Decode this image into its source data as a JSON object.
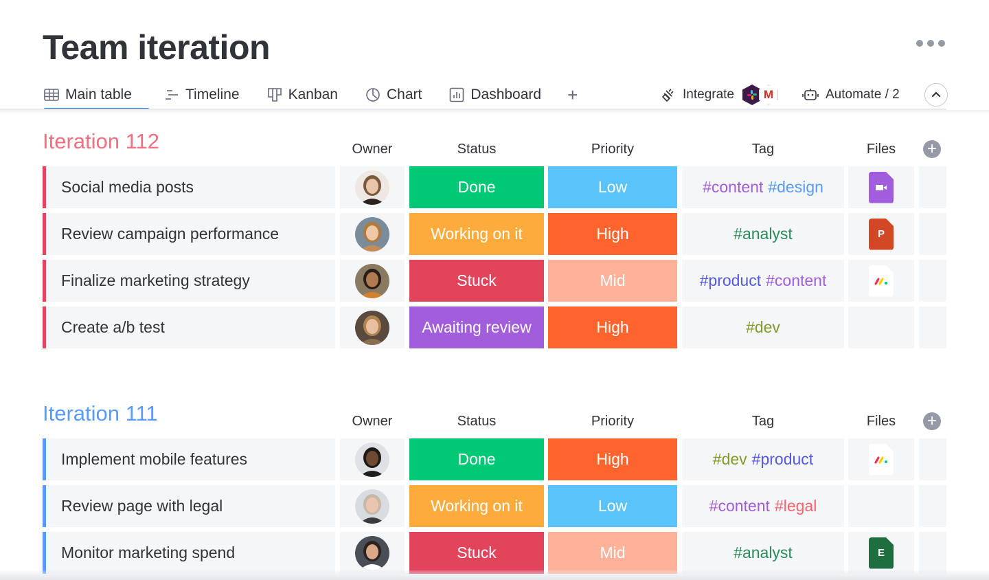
{
  "header": {
    "title": "Team iteration",
    "more_icon": "ellipsis-icon"
  },
  "tabs": [
    {
      "label": "Main table",
      "icon": "table-icon",
      "active": true
    },
    {
      "label": "Timeline",
      "icon": "timeline-icon",
      "active": false
    },
    {
      "label": "Kanban",
      "icon": "kanban-icon",
      "active": false
    },
    {
      "label": "Chart",
      "icon": "chart-pie-icon",
      "active": false
    },
    {
      "label": "Dashboard",
      "icon": "dashboard-icon",
      "active": false
    }
  ],
  "add_view_label": "+",
  "toolbar": {
    "integrate_label": "Integrate",
    "integrate_apps": [
      "slack-icon",
      "gmail-icon"
    ],
    "gmail_glyph": "M",
    "automate_label": "Automate / 2",
    "collapse_icon": "chevron-up-icon"
  },
  "columns": {
    "owner": "Owner",
    "status": "Status",
    "priority": "Priority",
    "tag": "Tag",
    "files": "Files"
  },
  "colors": {
    "accent": "#0073ea",
    "group_1": "#e2445c",
    "group_1_title": "#f16f7e",
    "group_2": "#579bfc",
    "status_done": "#00c875",
    "status_working": "#fdab3d",
    "status_stuck": "#e2445c",
    "status_awaiting": "#a25ddc",
    "priority_low": "#5ac4fa",
    "priority_high": "#ff642e",
    "priority_mid": "#ffb199",
    "tag_content": "#a25ddc",
    "tag_design": "#579bfc",
    "tag_analyst": "#2b8c5a",
    "tag_product": "#5559df",
    "tag_dev": "#7e9b2a",
    "tag_legal": "#f0646e"
  },
  "groups": [
    {
      "title": "Iteration 112",
      "rows": [
        {
          "name": "Social media posts",
          "owner": "avatar-woman-1",
          "status": "Done",
          "status_color": "#00c875",
          "priority": "Low",
          "priority_color": "#5ac4fa",
          "tags": [
            {
              "text": "#content",
              "color": "#a25ddc"
            },
            {
              "text": "#design",
              "color": "#579bfc"
            }
          ],
          "file": "video",
          "file_label": ""
        },
        {
          "name": "Review campaign performance",
          "owner": "avatar-woman-2",
          "status": "Working on it",
          "status_color": "#fdab3d",
          "priority": "High",
          "priority_color": "#ff642e",
          "tags": [
            {
              "text": "#analyst",
              "color": "#2b8c5a"
            }
          ],
          "file": "ppt",
          "file_label": "P"
        },
        {
          "name": "Finalize marketing strategy",
          "owner": "avatar-man-1",
          "status": "Stuck",
          "status_color": "#e2445c",
          "priority": "Mid",
          "priority_color": "#ffb199",
          "tags": [
            {
              "text": "#product",
              "color": "#5559df"
            },
            {
              "text": "#content",
              "color": "#a25ddc"
            }
          ],
          "file": "monday",
          "file_label": ""
        },
        {
          "name": "Create a/b test",
          "owner": "avatar-woman-3",
          "status": "Awaiting review",
          "status_color": "#a25ddc",
          "priority": "High",
          "priority_color": "#ff642e",
          "tags": [
            {
              "text": "#dev",
              "color": "#7e9b2a"
            }
          ],
          "file": "",
          "file_label": ""
        }
      ]
    },
    {
      "title": "Iteration 111",
      "rows": [
        {
          "name": "Implement mobile features",
          "owner": "avatar-man-2",
          "status": "Done",
          "status_color": "#00c875",
          "priority": "High",
          "priority_color": "#ff642e",
          "tags": [
            {
              "text": "#dev",
              "color": "#7e9b2a"
            },
            {
              "text": "#product",
              "color": "#5559df"
            }
          ],
          "file": "monday",
          "file_label": ""
        },
        {
          "name": "Review page with legal",
          "owner": "avatar-man-3",
          "status": "Working on it",
          "status_color": "#fdab3d",
          "priority": "Low",
          "priority_color": "#5ac4fa",
          "tags": [
            {
              "text": "#content",
              "color": "#a25ddc"
            },
            {
              "text": "#legal",
              "color": "#f0646e"
            }
          ],
          "file": "",
          "file_label": ""
        },
        {
          "name": "Monitor marketing spend",
          "owner": "avatar-woman-4",
          "status": "Stuck",
          "status_color": "#e2445c",
          "priority": "Mid",
          "priority_color": "#ffb199",
          "tags": [
            {
              "text": "#analyst",
              "color": "#2b8c5a"
            }
          ],
          "file": "xls",
          "file_label": "E"
        }
      ]
    }
  ]
}
